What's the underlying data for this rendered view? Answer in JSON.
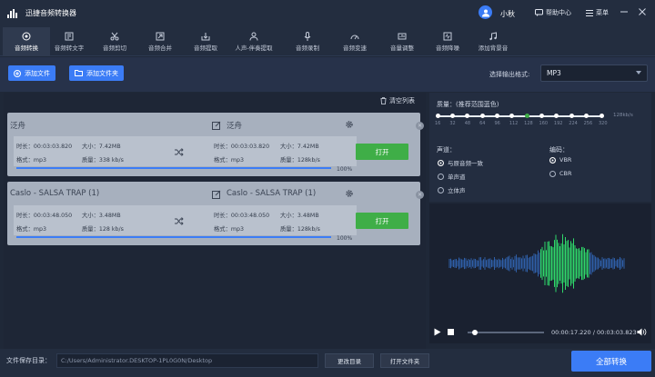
{
  "app": {
    "title": "迅捷音频转换器",
    "username": "小秋",
    "help": "帮助中心",
    "menu": "菜单"
  },
  "toolbar": [
    {
      "label": "音频转换",
      "icon": "convert-icon",
      "active": true
    },
    {
      "label": "音频转文字",
      "icon": "audio-to-text-icon"
    },
    {
      "label": "音频剪切",
      "icon": "scissors-icon"
    },
    {
      "label": "音频合并",
      "icon": "merge-icon"
    },
    {
      "label": "音频提取",
      "icon": "extract-icon"
    },
    {
      "label": "人声-伴奏提取",
      "icon": "vocal-icon"
    },
    {
      "label": "音频录制",
      "icon": "microphone-icon"
    },
    {
      "label": "音频变速",
      "icon": "speed-icon"
    },
    {
      "label": "音量调整",
      "icon": "volume-icon"
    },
    {
      "label": "音频降噪",
      "icon": "denoise-icon"
    },
    {
      "label": "添加背景音",
      "icon": "bg-music-icon"
    }
  ],
  "actions": {
    "add_file": "添加文件",
    "add_folder": "添加文件夹",
    "format_label": "选择输出格式:",
    "format_value": "MP3",
    "clear_list": "清空列表"
  },
  "files": [
    {
      "name": "泛舟",
      "output_name": "泛舟",
      "src": {
        "duration": "时长：00:03:03.820",
        "size": "大小：7.42MB",
        "format": "格式：mp3",
        "quality": "质量：338 kb/s"
      },
      "dst": {
        "duration": "时长：00:03:03.820",
        "size": "大小：7.42MB",
        "format": "格式：mp3",
        "quality": "质量：128kb/s"
      },
      "progress": 1.0,
      "progress_label": "100%",
      "open": "打开"
    },
    {
      "name": "Caslo - SALSA TRAP (1)",
      "output_name": "Caslo - SALSA TRAP (1)",
      "src": {
        "duration": "时长：00:03:48.050",
        "size": "大小：3.48MB",
        "format": "格式：mp3",
        "quality": "质量：128 kb/s"
      },
      "dst": {
        "duration": "时长：00:03:48.050",
        "size": "大小：3.48MB",
        "format": "格式：mp3",
        "quality": "质量：128kb/s"
      },
      "progress": 1.0,
      "progress_label": "100%",
      "open": "打开"
    }
  ],
  "settings": {
    "quality_label": "质量：(推荐范围蓝色)",
    "quality_ticks": [
      "16",
      "32",
      "48",
      "64",
      "96",
      "112",
      "128",
      "160",
      "192",
      "224",
      "256",
      "320"
    ],
    "quality_selected": "128",
    "quality_unit": "128kb/s",
    "channel_label": "声道：",
    "channels": [
      {
        "label": "与原音频一致",
        "on": true
      },
      {
        "label": "单声道",
        "on": false
      },
      {
        "label": "立体声",
        "on": false
      }
    ],
    "encoding_label": "编码：",
    "encodings": [
      {
        "label": "VBR",
        "on": true
      },
      {
        "label": "CBR",
        "on": false
      }
    ]
  },
  "player": {
    "time": "00:00:17.220 / 00:03:03.823",
    "position": 0.094
  },
  "bottom": {
    "save_label": "文件保存目录：",
    "path": "C:/Users/Administrator.DESKTOP-1PL0G0N/Desktop",
    "change_dir": "更改目录",
    "open_folder": "打开文件夹",
    "convert_all": "全部转换"
  },
  "colors": {
    "accent": "#3b7cf6",
    "open_button": "#3fae47",
    "wave_green": "#2fd86a",
    "wave_blue": "#2f5fa8"
  }
}
